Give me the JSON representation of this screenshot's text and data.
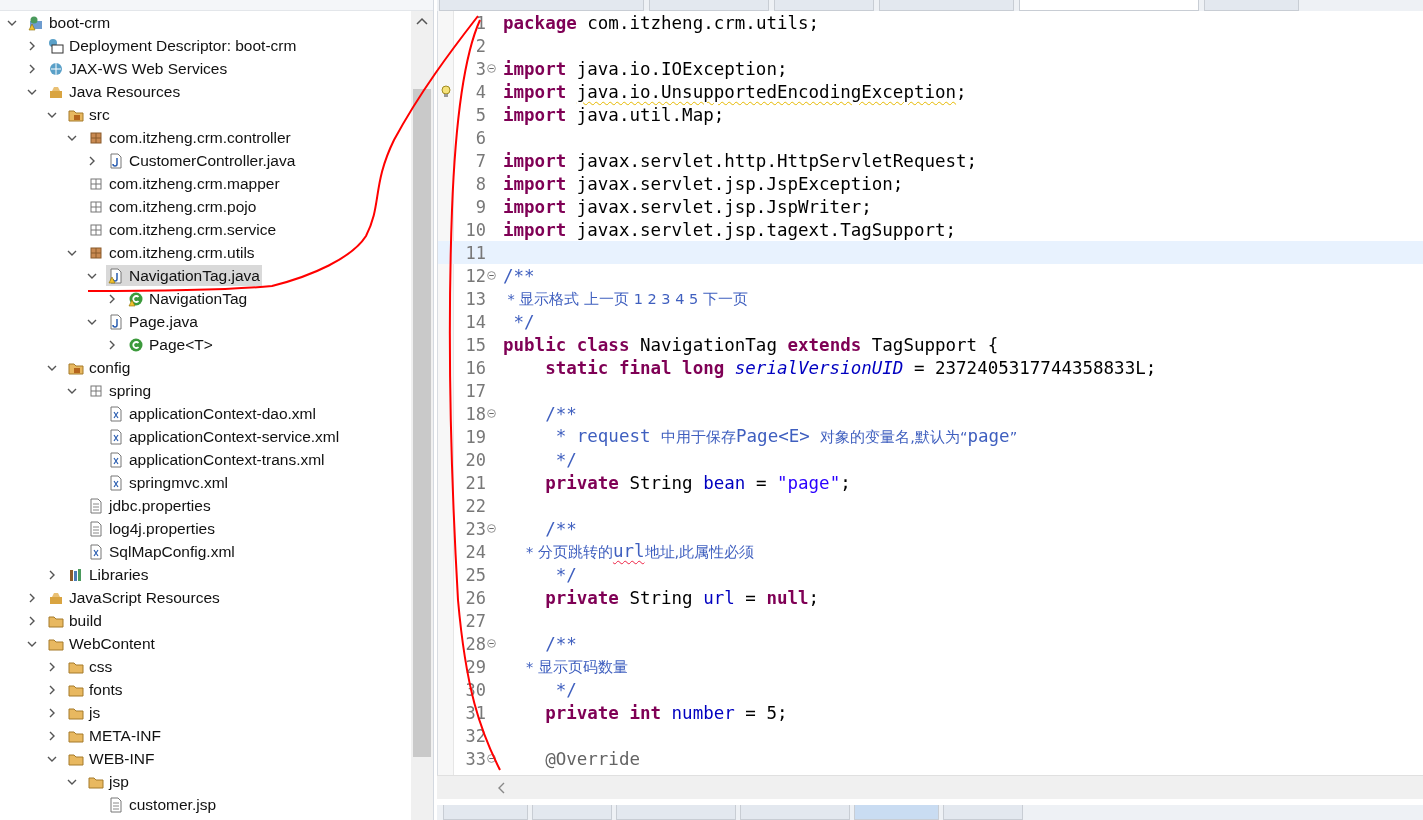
{
  "project_explorer": {
    "tree": [
      {
        "label": "boot-crm",
        "kind": "project",
        "warning": true,
        "expanded": true,
        "selected": false,
        "children": [
          {
            "label": "Deployment Descriptor: boot-crm",
            "kind": "descriptor",
            "expanded": false,
            "selected": false
          },
          {
            "label": "JAX-WS Web Services",
            "kind": "services",
            "expanded": false,
            "selected": false
          },
          {
            "label": "Java Resources",
            "kind": "resources",
            "expanded": true,
            "selected": false,
            "children": [
              {
                "label": "src",
                "kind": "source-folder",
                "expanded": true,
                "selected": false,
                "children": [
                  {
                    "label": "com.itzheng.crm.controller",
                    "kind": "package",
                    "expanded": true,
                    "selected": false,
                    "children": [
                      {
                        "label": "CustomerController.java",
                        "kind": "java-file",
                        "expanded": false,
                        "selected": false
                      }
                    ]
                  },
                  {
                    "label": "com.itzheng.crm.mapper",
                    "kind": "empty-package",
                    "selected": false
                  },
                  {
                    "label": "com.itzheng.crm.pojo",
                    "kind": "empty-package",
                    "selected": false
                  },
                  {
                    "label": "com.itzheng.crm.service",
                    "kind": "empty-package",
                    "selected": false
                  },
                  {
                    "label": "com.itzheng.crm.utils",
                    "kind": "package",
                    "expanded": true,
                    "selected": false,
                    "children": [
                      {
                        "label": "NavigationTag.java",
                        "kind": "java-file",
                        "warning": true,
                        "expanded": true,
                        "selected": true,
                        "children": [
                          {
                            "label": "NavigationTag",
                            "kind": "class",
                            "warning": true,
                            "expanded": false,
                            "selected": false
                          }
                        ]
                      },
                      {
                        "label": "Page.java",
                        "kind": "java-file",
                        "expanded": true,
                        "selected": false,
                        "children": [
                          {
                            "label": "Page<T>",
                            "kind": "class",
                            "expanded": false,
                            "selected": false
                          }
                        ]
                      }
                    ]
                  }
                ]
              },
              {
                "label": "config",
                "kind": "source-folder",
                "expanded": true,
                "selected": false,
                "children": [
                  {
                    "label": "spring",
                    "kind": "empty-package",
                    "expanded": true,
                    "selected": false,
                    "children": [
                      {
                        "label": "applicationContext-dao.xml",
                        "kind": "xml-file",
                        "selected": false
                      },
                      {
                        "label": "applicationContext-service.xml",
                        "kind": "xml-file",
                        "selected": false
                      },
                      {
                        "label": "applicationContext-trans.xml",
                        "kind": "xml-file",
                        "selected": false
                      },
                      {
                        "label": "springmvc.xml",
                        "kind": "xml-file",
                        "selected": false
                      }
                    ]
                  },
                  {
                    "label": "jdbc.properties",
                    "kind": "text-file",
                    "selected": false
                  },
                  {
                    "label": "log4j.properties",
                    "kind": "text-file",
                    "selected": false
                  },
                  {
                    "label": "SqlMapConfig.xml",
                    "kind": "xml-file",
                    "selected": false
                  }
                ]
              },
              {
                "label": "Libraries",
                "kind": "library",
                "expanded": false,
                "selected": false
              }
            ]
          },
          {
            "label": "JavaScript Resources",
            "kind": "resources",
            "expanded": false,
            "selected": false
          },
          {
            "label": "build",
            "kind": "folder",
            "expanded": false,
            "selected": false
          },
          {
            "label": "WebContent",
            "kind": "folder",
            "expanded": true,
            "selected": false,
            "children": [
              {
                "label": "css",
                "kind": "folder",
                "expanded": false,
                "selected": false
              },
              {
                "label": "fonts",
                "kind": "folder",
                "expanded": false,
                "selected": false
              },
              {
                "label": "js",
                "kind": "folder",
                "expanded": false,
                "selected": false
              },
              {
                "label": "META-INF",
                "kind": "folder",
                "expanded": false,
                "selected": false
              },
              {
                "label": "WEB-INF",
                "kind": "folder",
                "expanded": true,
                "selected": false,
                "children": [
                  {
                    "label": "jsp",
                    "kind": "folder",
                    "expanded": true,
                    "selected": false,
                    "children": [
                      {
                        "label": "customer.jsp",
                        "kind": "jsp-file",
                        "selected": false
                      }
                    ]
                  }
                ]
              }
            ]
          }
        ]
      }
    ]
  },
  "editor_tabs": [
    {
      "selected": false
    },
    {
      "selected": false
    },
    {
      "selected": false
    },
    {
      "selected": false
    },
    {
      "selected": true
    },
    {
      "selected": false
    }
  ],
  "editor": {
    "lines": [
      {
        "number": "1",
        "tokens": [
          {
            "kind": "keyword",
            "text": "package"
          },
          {
            "kind": "plain",
            "text": " com.itzheng.crm.utils;"
          }
        ]
      },
      {
        "number": "2"
      },
      {
        "number": "3",
        "fold": true,
        "tokens": [
          {
            "kind": "keyword",
            "text": "import"
          },
          {
            "kind": "plain",
            "text": " java.io.IOException;"
          }
        ]
      },
      {
        "number": "4",
        "warning": true,
        "tokens": [
          {
            "kind": "keyword",
            "text": "import "
          },
          {
            "kind": "plain",
            "text": "java.io.UnsupportedEncodingException",
            "warning_underline": true
          },
          {
            "kind": "plain",
            "text": ";"
          }
        ]
      },
      {
        "number": "5",
        "tokens": [
          {
            "kind": "keyword",
            "text": "import"
          },
          {
            "kind": "plain",
            "text": " java.util.Map;"
          }
        ]
      },
      {
        "number": "6"
      },
      {
        "number": "7",
        "tokens": [
          {
            "kind": "keyword",
            "text": "import"
          },
          {
            "kind": "plain",
            "text": " javax.servlet.http.HttpServletRequest;"
          }
        ]
      },
      {
        "number": "8",
        "tokens": [
          {
            "kind": "keyword",
            "text": "import"
          },
          {
            "kind": "plain",
            "text": " javax.servlet.jsp.JspException;"
          }
        ]
      },
      {
        "number": "9",
        "tokens": [
          {
            "kind": "keyword",
            "text": "import"
          },
          {
            "kind": "plain",
            "text": " javax.servlet.jsp.JspWriter;"
          }
        ]
      },
      {
        "number": "10",
        "tokens": [
          {
            "kind": "keyword",
            "text": "import"
          },
          {
            "kind": "plain",
            "text": " javax.servlet.jsp.tagext.TagSupport;"
          }
        ]
      },
      {
        "number": "11",
        "current": true
      },
      {
        "number": "12",
        "fold": true,
        "tokens": [
          {
            "kind": "doc",
            "text": "/**"
          }
        ]
      },
      {
        "number": "13",
        "tokens": [
          {
            "kind": "doc-cjk",
            "text": " * 显示格式 上一页 1 2 3 4 5 下一页"
          }
        ]
      },
      {
        "number": "14",
        "tokens": [
          {
            "kind": "doc",
            "text": " */"
          }
        ]
      },
      {
        "number": "15",
        "tokens": [
          {
            "kind": "keyword",
            "text": "public class"
          },
          {
            "kind": "plain",
            "text": " NavigationTag "
          },
          {
            "kind": "keyword",
            "text": "extends"
          },
          {
            "kind": "plain",
            "text": " TagSupport {"
          }
        ]
      },
      {
        "number": "16",
        "tokens": [
          {
            "kind": "keyword",
            "text": "    static final long "
          },
          {
            "kind": "static-field",
            "text": "serialVersionUID"
          },
          {
            "kind": "plain",
            "text": " = 2372405317744358833L;"
          }
        ]
      },
      {
        "number": "17"
      },
      {
        "number": "18",
        "fold": true,
        "tokens": [
          {
            "kind": "doc",
            "text": "    /**"
          }
        ]
      },
      {
        "number": "19",
        "tokens": [
          {
            "kind": "doc",
            "text": "     * request "
          },
          {
            "kind": "doc-cjk",
            "text": "中用于保存"
          },
          {
            "kind": "doc",
            "text": "Page<E> "
          },
          {
            "kind": "doc-cjk",
            "text": "对象的变量名,默认为“"
          },
          {
            "kind": "doc",
            "text": "page"
          },
          {
            "kind": "doc-cjk",
            "text": "”"
          }
        ]
      },
      {
        "number": "20",
        "tokens": [
          {
            "kind": "doc",
            "text": "     */"
          }
        ]
      },
      {
        "number": "21",
        "tokens": [
          {
            "kind": "keyword",
            "text": "    private"
          },
          {
            "kind": "plain",
            "text": " String "
          },
          {
            "kind": "field",
            "text": "bean"
          },
          {
            "kind": "plain",
            "text": " = "
          },
          {
            "kind": "string",
            "text": "\"page\""
          },
          {
            "kind": "plain",
            "text": ";"
          }
        ]
      },
      {
        "number": "22"
      },
      {
        "number": "23",
        "fold": true,
        "tokens": [
          {
            "kind": "doc",
            "text": "    /**"
          }
        ]
      },
      {
        "number": "24",
        "tokens": [
          {
            "kind": "doc-cjk",
            "text": "     * 分页跳转的"
          },
          {
            "kind": "doc",
            "text": "url",
            "spelling_underline": true
          },
          {
            "kind": "doc-cjk",
            "text": "地址,此属性必须"
          }
        ]
      },
      {
        "number": "25",
        "tokens": [
          {
            "kind": "doc",
            "text": "     */"
          }
        ]
      },
      {
        "number": "26",
        "tokens": [
          {
            "kind": "keyword",
            "text": "    private"
          },
          {
            "kind": "plain",
            "text": " String "
          },
          {
            "kind": "field",
            "text": "url"
          },
          {
            "kind": "plain",
            "text": " = "
          },
          {
            "kind": "keyword",
            "text": "null"
          },
          {
            "kind": "plain",
            "text": ";"
          }
        ]
      },
      {
        "number": "27"
      },
      {
        "number": "28",
        "fold": true,
        "tokens": [
          {
            "kind": "doc",
            "text": "    /**"
          }
        ]
      },
      {
        "number": "29",
        "tokens": [
          {
            "kind": "doc-cjk",
            "text": "     * 显示页码数量"
          }
        ]
      },
      {
        "number": "30",
        "tokens": [
          {
            "kind": "doc",
            "text": "     */"
          }
        ]
      },
      {
        "number": "31",
        "tokens": [
          {
            "kind": "keyword",
            "text": "    private int "
          },
          {
            "kind": "field",
            "text": "number"
          },
          {
            "kind": "plain",
            "text": " = 5;"
          }
        ]
      },
      {
        "number": "32"
      },
      {
        "number": "33",
        "fold": true,
        "tokens": [
          {
            "kind": "annotation",
            "text": "    @Override"
          }
        ]
      }
    ]
  },
  "view_tabs": [
    {
      "selected": false
    },
    {
      "selected": false
    },
    {
      "selected": false
    },
    {
      "selected": false
    },
    {
      "selected": true
    },
    {
      "selected": false
    }
  ]
}
